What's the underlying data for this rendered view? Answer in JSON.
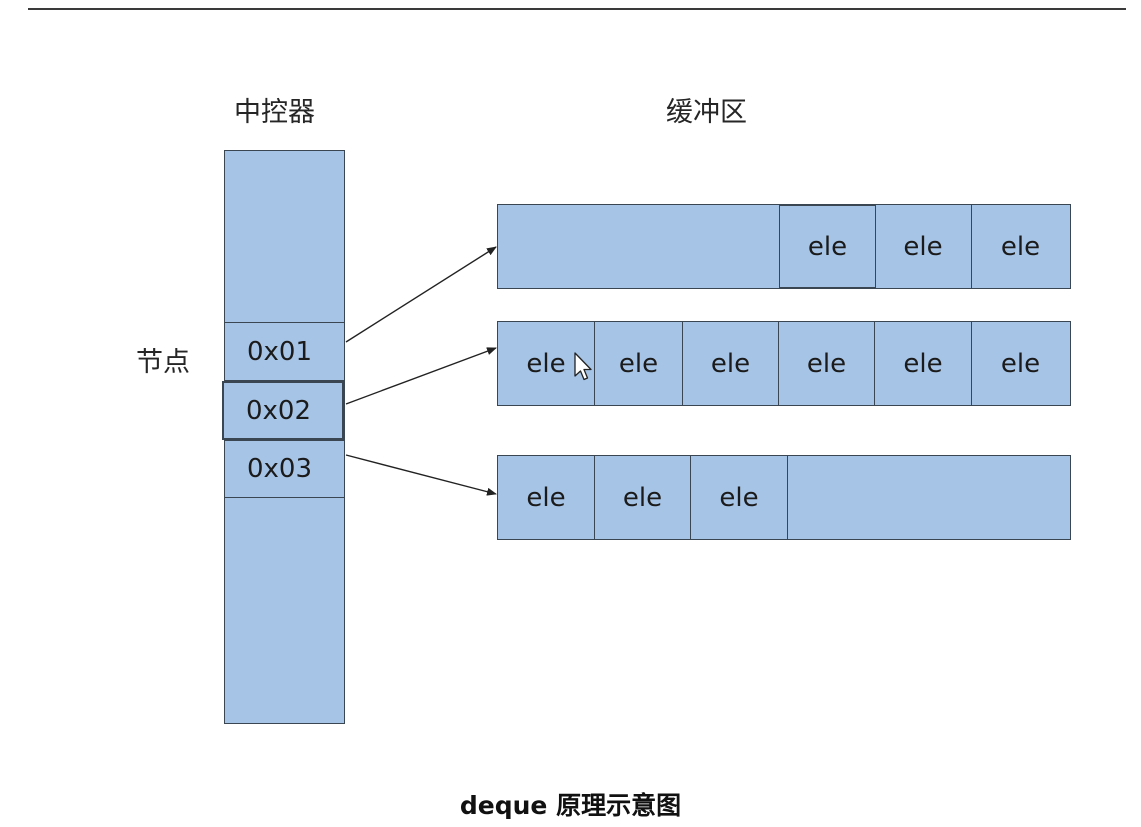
{
  "headings": {
    "map": "中控器",
    "buffer": "缓冲区",
    "node": "节点"
  },
  "map": {
    "nodes": [
      "0x01",
      "0x02",
      "0x03"
    ]
  },
  "buffers": [
    {
      "cells": [
        "",
        "ele",
        "ele",
        "ele"
      ]
    },
    {
      "cells": [
        "ele",
        "ele",
        "ele",
        "ele",
        "ele",
        "ele"
      ]
    },
    {
      "cells": [
        "ele",
        "ele",
        "ele",
        ""
      ]
    }
  ],
  "caption": "deque 原理示意图",
  "colors": {
    "fill": "#a6c4e6",
    "border": "#3b4653",
    "arrow": "#222222"
  },
  "icons": {
    "cursor": "mouse-pointer-icon"
  }
}
